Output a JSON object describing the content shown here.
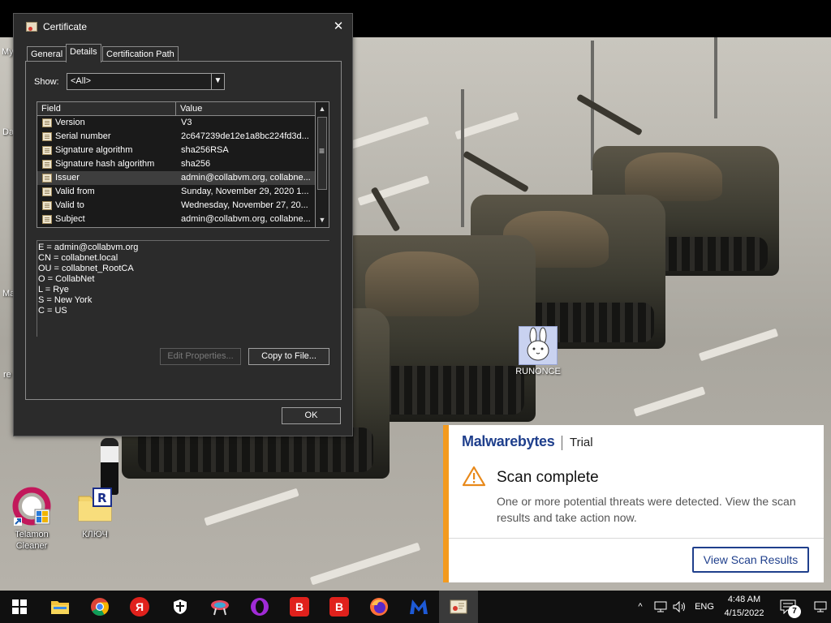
{
  "desktop": {
    "icons": [
      {
        "label": "Telamon Cleaner"
      },
      {
        "label": "КЛЮЧ"
      }
    ],
    "edge_labels": [
      "My",
      "Da",
      "Ma",
      "re"
    ],
    "runonce_label": "RUNONCE"
  },
  "dialog": {
    "title": "Certificate",
    "close_glyph": "✕",
    "tabs": [
      "General",
      "Details",
      "Certification Path"
    ],
    "active_tab": "Details",
    "show_label": "Show:",
    "show_value": "<All>",
    "columns": {
      "field": "Field",
      "value": "Value"
    },
    "rows": [
      {
        "field": "Version",
        "value": "V3"
      },
      {
        "field": "Serial number",
        "value": "2c647239de12e1a8bc224fd3d..."
      },
      {
        "field": "Signature algorithm",
        "value": "sha256RSA"
      },
      {
        "field": "Signature hash algorithm",
        "value": "sha256"
      },
      {
        "field": "Issuer",
        "value": "admin@collabvm.org, collabne..."
      },
      {
        "field": "Valid from",
        "value": "Sunday, November 29, 2020 1..."
      },
      {
        "field": "Valid to",
        "value": "Wednesday, November 27, 20..."
      },
      {
        "field": "Subject",
        "value": "admin@collabvm.org, collabne..."
      }
    ],
    "selected_row": "Issuer",
    "details": [
      "E = admin@collabvm.org",
      "CN = collabnet.local",
      "OU = collabnet_RootCA",
      "O = CollabNet",
      "L = Rye",
      "S = New York",
      "C = US"
    ],
    "edit_properties_label": "Edit Properties...",
    "copy_to_file_label": "Copy to File...",
    "ok_label": "OK"
  },
  "toast": {
    "brand": "Malwarebytes",
    "edition": "Trial",
    "heading": "Scan complete",
    "body": "One or more potential threats were detected. View the scan results and take action now.",
    "action_label": "View Scan Results",
    "accent_color": "#f39a1e",
    "brand_color": "#1f3f8c"
  },
  "taskbar": {
    "apps": [
      "start-icon",
      "file-explorer-icon",
      "chrome-icon",
      "yandex-icon",
      "shield-app-icon",
      "sun-app-icon",
      "opera-icon",
      "b-app-icon",
      "b-app-icon-2",
      "firefox-icon",
      "malwarebytes-icon",
      "certificate-window-icon"
    ],
    "yandex_glyph": "Я",
    "b_glyph": "B",
    "language": "ENG",
    "time": "4:48 AM",
    "date": "4/15/2022",
    "notifications_count": "7"
  }
}
